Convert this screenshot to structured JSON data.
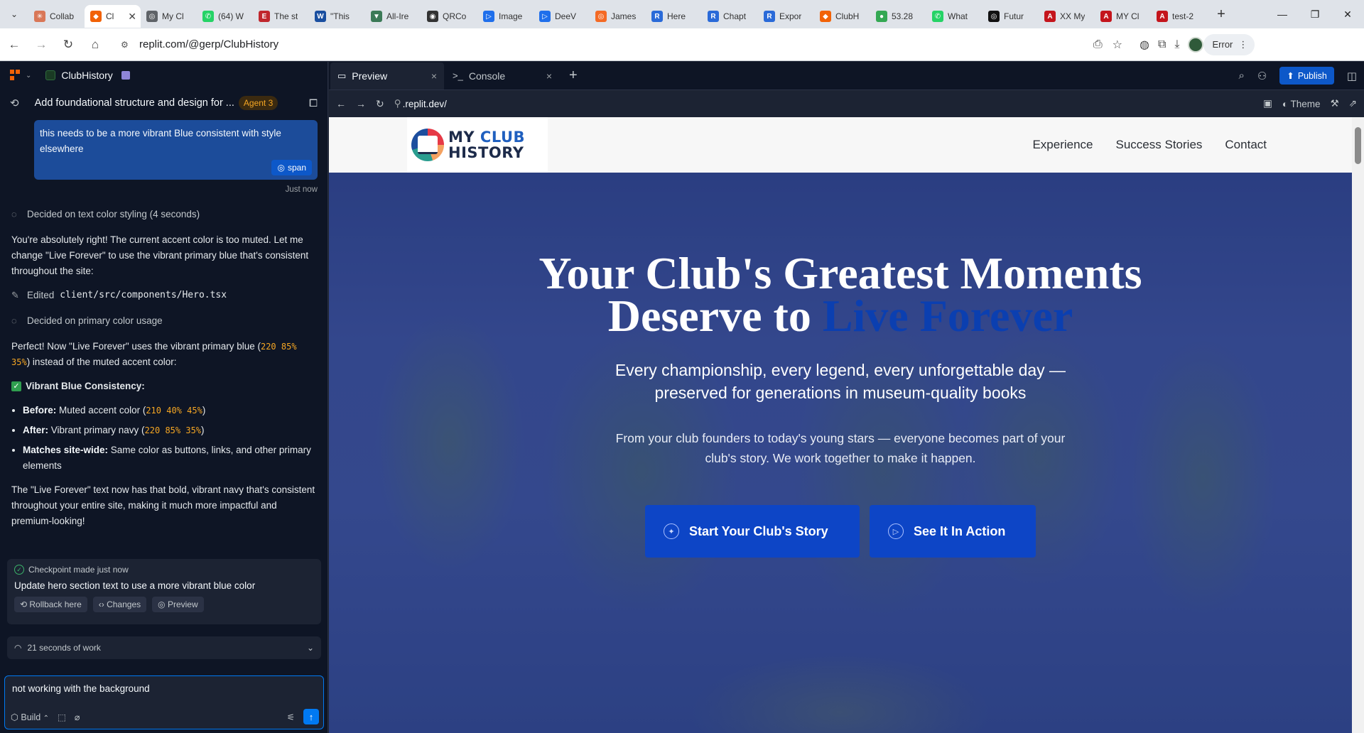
{
  "browser": {
    "tabs": [
      {
        "label": "Collab",
        "color": "#d97757",
        "glyph": "✳"
      },
      {
        "label": "Cl",
        "color": "#f26207",
        "glyph": "◆",
        "active": true
      },
      {
        "label": "My Cl",
        "color": "#5f6368",
        "glyph": "◎"
      },
      {
        "label": "(64) W",
        "color": "#25d366",
        "glyph": "✆"
      },
      {
        "label": "The st",
        "color": "#c0272d",
        "glyph": "E"
      },
      {
        "label": "\"This",
        "color": "#1a4fa0",
        "glyph": "W"
      },
      {
        "label": "All-Ire",
        "color": "#3b7a57",
        "glyph": "▼"
      },
      {
        "label": "QRCo",
        "color": "#333333",
        "glyph": "◉"
      },
      {
        "label": "Image",
        "color": "#1f6feb",
        "glyph": "▷"
      },
      {
        "label": "DeeV",
        "color": "#1f6feb",
        "glyph": "▷"
      },
      {
        "label": "James",
        "color": "#f46a25",
        "glyph": "◎"
      },
      {
        "label": "Here",
        "color": "#2a6ad8",
        "glyph": "R"
      },
      {
        "label": "Chapt",
        "color": "#2a6ad8",
        "glyph": "R"
      },
      {
        "label": "Expor",
        "color": "#2a6ad8",
        "glyph": "R"
      },
      {
        "label": "ClubH",
        "color": "#f26207",
        "glyph": "◆"
      },
      {
        "label": "53.28",
        "color": "#34a853",
        "glyph": "●"
      },
      {
        "label": "What",
        "color": "#25d366",
        "glyph": "✆"
      },
      {
        "label": "Futur",
        "color": "#111111",
        "glyph": "◎"
      },
      {
        "label": "XX My",
        "color": "#c4151c",
        "glyph": "A"
      },
      {
        "label": "MY Cl",
        "color": "#c4151c",
        "glyph": "A"
      },
      {
        "label": "test-2",
        "color": "#c4151c",
        "glyph": "A"
      }
    ],
    "url": "replit.com/@gerp/ClubHistory",
    "error_label": "Error"
  },
  "agent_panel": {
    "project_name": "ClubHistory",
    "thread_title": "Add foundational structure and design for ...",
    "agent_badge": "Agent 3",
    "user_message": "this needs to be a more vibrant Blue consistent with style elsewhere",
    "span_chip": "span",
    "timestamp": "Just now",
    "decided_text": "Decided on text color styling (4 seconds)",
    "para1": "You're absolutely right! The current accent color is too muted. Let me change \"Live Forever\" to use the vibrant primary blue that's consistent throughout the site:",
    "edited_label": "Edited",
    "edited_file": "client/src/components/Hero.tsx",
    "decided_primary": "Decided on primary color usage",
    "para2_a": "Perfect! Now \"Live Forever\" uses the vibrant primary blue (",
    "para2_code": "220 85% 35%",
    "para2_b": ") instead of the muted accent color:",
    "check_title": "Vibrant Blue Consistency:",
    "bullets": [
      {
        "bold": "Before:",
        "text": " Muted accent color (",
        "code": "210 40% 45%",
        "tail": ")"
      },
      {
        "bold": "After:",
        "text": " Vibrant primary navy (",
        "code": "220 85% 35%",
        "tail": ")"
      },
      {
        "bold": "Matches site-wide:",
        "text": " Same color as buttons, links, and other primary elements",
        "code": "",
        "tail": ""
      }
    ],
    "para3": "The \"Live Forever\" text now has that bold, vibrant navy that's consistent throughout your entire site, making it much more impactful and premium-looking!",
    "checkpoint": {
      "head": "Checkpoint made just now",
      "message": "Update hero section text to use a more vibrant blue color",
      "actions": [
        "Rollback here",
        "Changes",
        "Preview"
      ]
    },
    "work_summary": "21 seconds of work",
    "input_value": "not working with the background",
    "build_label": "Build"
  },
  "workspace": {
    "tabs": [
      {
        "label": "Preview",
        "icon": "▭"
      },
      {
        "label": "Console",
        "icon": ">_"
      }
    ],
    "publish_label": "Publish",
    "preview_url": ".replit.dev/",
    "theme_label": "Theme"
  },
  "site": {
    "logo_line1_a": "MY",
    "logo_line1_b": "CLUB",
    "logo_line2": "HISTORY",
    "nav": [
      "Experience",
      "Success Stories",
      "Contact"
    ],
    "hero_line1": "Your Club's Greatest Moments",
    "hero_line2_a": "Deserve to ",
    "hero_line2_accent": "Live Forever",
    "hero_sub": "Every championship, every legend, every unforgettable day — preserved for generations in museum-quality books",
    "hero_p": "From your club founders to today's young stars — everyone becomes part of your club's story. We work together to make it happen.",
    "cta_primary": "Start Your Club's Story",
    "cta_secondary": "See It In Action"
  }
}
